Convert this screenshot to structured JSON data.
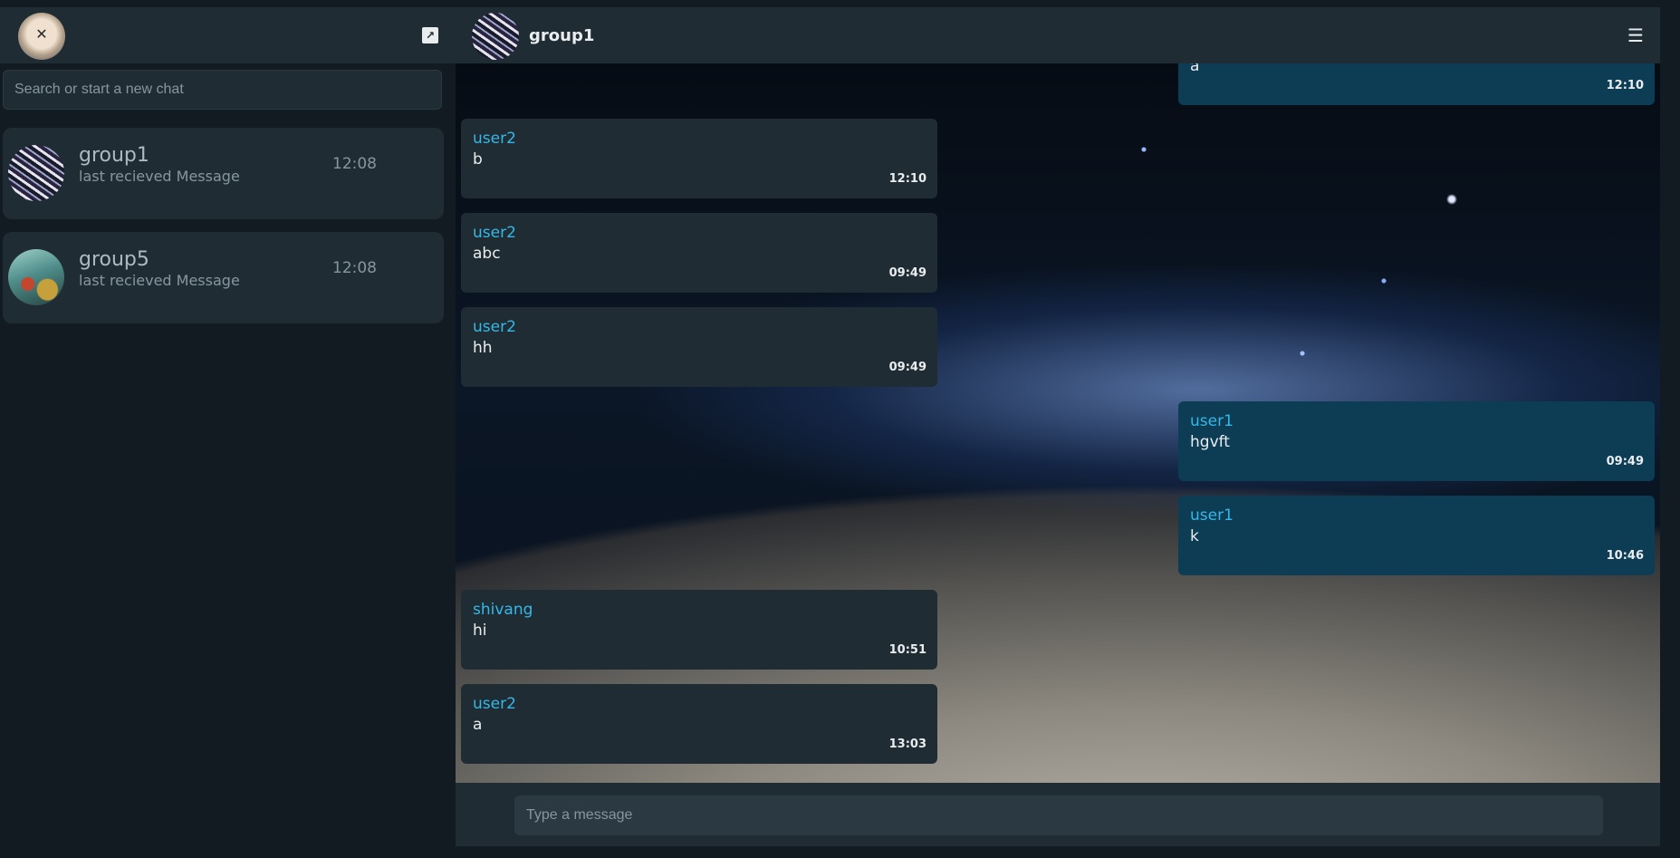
{
  "sidebar": {
    "new_chat_icon": "arrow-up-right-icon",
    "search": {
      "placeholder": "Search or start a new chat",
      "value": ""
    },
    "chats": [
      {
        "name": "group1",
        "last_message": "last recieved Message",
        "time": "12:08"
      },
      {
        "name": "group5",
        "last_message": "last recieved Message",
        "time": "12:08"
      }
    ]
  },
  "header": {
    "title": "group1",
    "menu_icon": "hamburger-menu-icon"
  },
  "messages": [
    {
      "direction": "out",
      "sender": "",
      "text": "a",
      "time": "12:10"
    },
    {
      "direction": "in",
      "sender": "user2",
      "text": "b",
      "time": "12:10"
    },
    {
      "direction": "in",
      "sender": "user2",
      "text": "abc",
      "time": "09:49"
    },
    {
      "direction": "in",
      "sender": "user2",
      "text": "hh",
      "time": "09:49"
    },
    {
      "direction": "out",
      "sender": "user1",
      "text": "hgvft",
      "time": "09:49"
    },
    {
      "direction": "out",
      "sender": "user1",
      "text": "k",
      "time": "10:46"
    },
    {
      "direction": "in",
      "sender": "shivang",
      "text": "hi",
      "time": "10:51"
    },
    {
      "direction": "in",
      "sender": "user2",
      "text": "a",
      "time": "13:03"
    }
  ],
  "composer": {
    "placeholder": "Type a message",
    "value": ""
  },
  "colors": {
    "background": "#111b21",
    "panel": "#202c33",
    "incoming_bubble": "#202c33",
    "outgoing_bubble": "#0c3d55",
    "sender_name": "#35b8e8"
  }
}
